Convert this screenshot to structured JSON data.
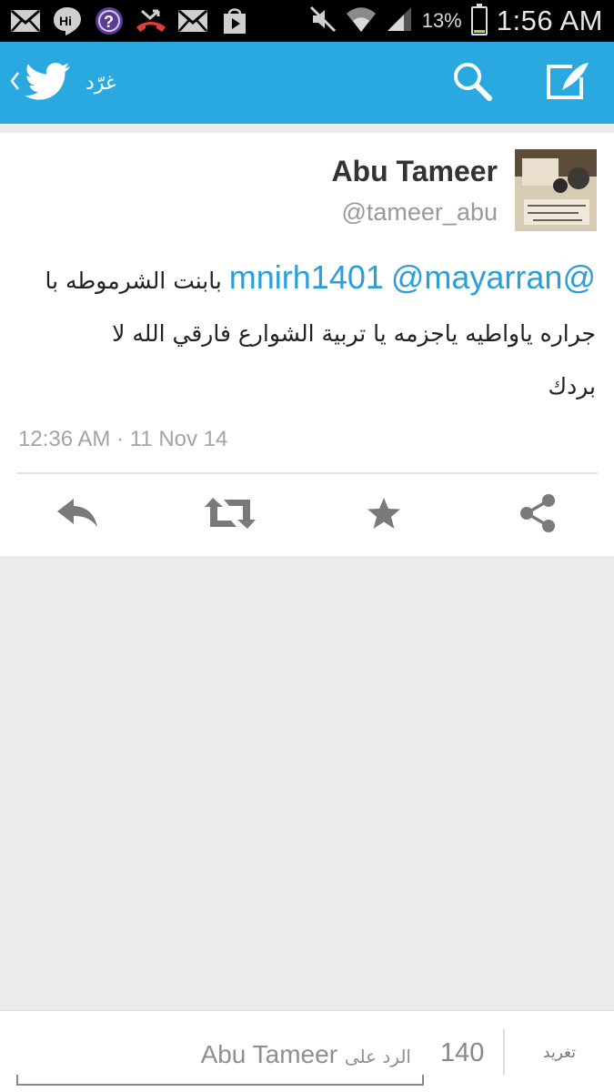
{
  "status_bar": {
    "icons": [
      "email-icon",
      "hangouts-icon",
      "voicemail-icon",
      "missed-call-icon",
      "email-icon",
      "play-store-icon"
    ],
    "battery_percent": "13%",
    "time": "1:56 AM"
  },
  "action_bar": {
    "title": "غرّد",
    "brand_color": "#2aa9e0"
  },
  "tweet": {
    "author_name": "Abu Tameer",
    "author_handle": "@tameer_abu",
    "mention_1": "@mnirh1401",
    "mention_2": "@mayarran",
    "text_part_1": " بابنت الشرموطه با",
    "text_line_2": "جراره ياواطيه ياجزمه يا تربية الشوارع فارقي الله لا",
    "text_line_3": "بردك",
    "timestamp": "12:36 AM · 11 Nov 14"
  },
  "reply_bar": {
    "placeholder_prefix": "الرد على",
    "placeholder_name": "Abu Tameer",
    "char_count": "140",
    "tweet_button_label": "تغريد"
  }
}
